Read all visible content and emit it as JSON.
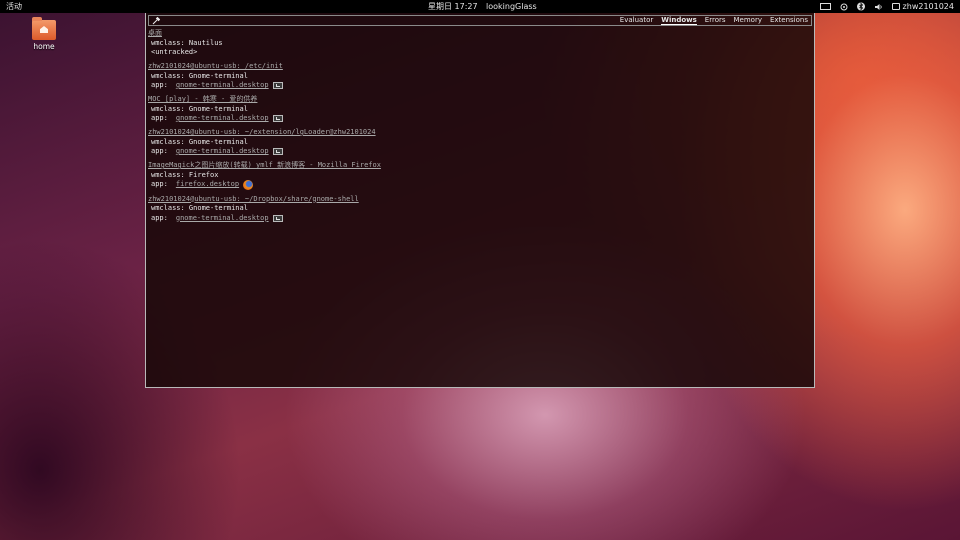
{
  "panel": {
    "activities": "活动",
    "clock": "星期日 17:27",
    "app_name": "lookingGlass",
    "username": "zhw2101024",
    "tray_icons": [
      "keyboard-icon",
      "network-icon",
      "bluetooth-icon",
      "volume-icon",
      "user-icon"
    ]
  },
  "desktop": {
    "icons": [
      {
        "label": "home",
        "icon": "home-folder-icon"
      }
    ]
  },
  "looking_glass": {
    "tabs": [
      {
        "label": "Evaluator",
        "active": false
      },
      {
        "label": "Windows",
        "active": true
      },
      {
        "label": "Errors",
        "active": false
      },
      {
        "label": "Memory",
        "active": false
      },
      {
        "label": "Extensions",
        "active": false
      }
    ],
    "windows": [
      {
        "title": "桌面",
        "wmclass": "wmclass: Nautilus",
        "extra": "<untracked>"
      },
      {
        "title": "zhw2101024@ubuntu-usb: /etc/init",
        "wmclass": "wmclass: Gnome-terminal",
        "app_label": "app:",
        "app": "gnome-terminal.desktop",
        "icon": "terminal-icon"
      },
      {
        "title": "MOC [play] - 韩寒 - 爱的供养",
        "wmclass": "wmclass: Gnome-terminal",
        "app_label": "app:",
        "app": "gnome-terminal.desktop",
        "icon": "terminal-icon"
      },
      {
        "title": "zhw2101024@ubuntu-usb: ~/extension/lgLoader@zhw2101024",
        "wmclass": "wmclass: Gnome-terminal",
        "app_label": "app:",
        "app": "gnome-terminal.desktop",
        "icon": "terminal-icon"
      },
      {
        "title": "ImageMagick之图片缩放(转载) ymlf 新浪博客 - Mozilla Firefox",
        "wmclass": "wmclass: Firefox",
        "app_label": "app:",
        "app": "firefox.desktop",
        "icon": "firefox-icon"
      },
      {
        "title": "zhw2101024@ubuntu-usb: ~/Dropbox/share/gnome-shell",
        "wmclass": "wmclass: Gnome-terminal",
        "app_label": "app:",
        "app": "gnome-terminal.desktop",
        "icon": "terminal-icon"
      }
    ]
  }
}
